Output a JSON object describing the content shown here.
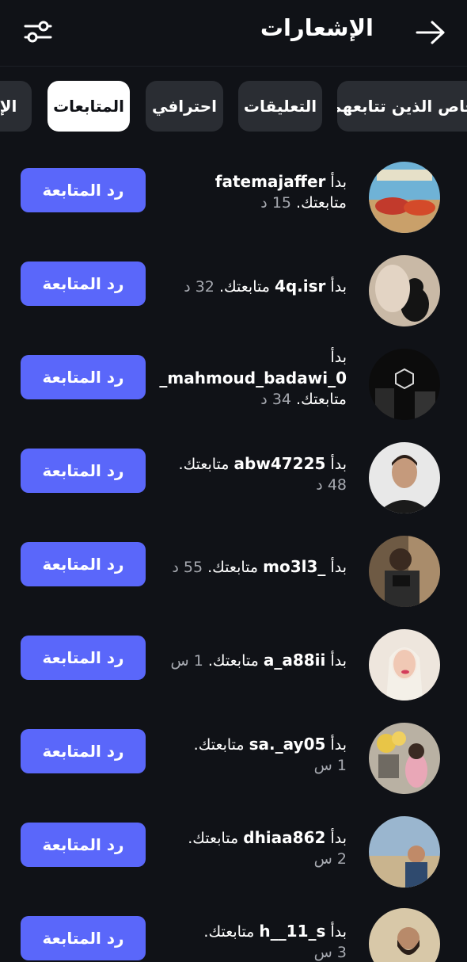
{
  "header": {
    "title": "الإشعارات"
  },
  "tabs": [
    {
      "label": "خاص الذين تتابعهم"
    },
    {
      "label": "التعليقات"
    },
    {
      "label": "احترافي"
    },
    {
      "label": "المتابعات"
    },
    {
      "label": "الإش"
    }
  ],
  "active_tab": "المتابعات",
  "notifications": [
    {
      "prefix": "بدأ",
      "username": "fatemajaffer",
      "suffix": "متابعتك.",
      "time": "15 د",
      "button": "رد المتابعة"
    },
    {
      "prefix": "بدأ",
      "username": "4q.isr",
      "suffix": "متابعتك.",
      "time": "32 د",
      "button": "رد المتابعة"
    },
    {
      "prefix": "بدأ",
      "username": "mahmoud_badawi_0_",
      "suffix": "متابعتك.",
      "time": "34 د",
      "button": "رد المتابعة"
    },
    {
      "prefix": "بدأ",
      "username": "abw47225",
      "suffix": "متابعتك.",
      "time": "48 د",
      "button": "رد المتابعة"
    },
    {
      "prefix": "بدأ",
      "username": "_mo3l3",
      "suffix": "متابعتك.",
      "time": "55 د",
      "button": "رد المتابعة"
    },
    {
      "prefix": "بدأ",
      "username": "a_a88ii",
      "suffix": "متابعتك.",
      "time": "1 س",
      "button": "رد المتابعة"
    },
    {
      "prefix": "بدأ",
      "username": "sa._ay05",
      "suffix": "متابعتك.",
      "time": "1 س",
      "button": "رد المتابعة"
    },
    {
      "prefix": "بدأ",
      "username": "dhiaa862",
      "suffix": "متابعتك.",
      "time": "2 س",
      "button": "رد المتابعة"
    },
    {
      "prefix": "بدأ",
      "username": "h__11_s",
      "suffix": "متابعتك.",
      "time": "3 س",
      "button": "رد المتابعة"
    }
  ],
  "colors": {
    "background": "#101217",
    "button": "#5a67fa",
    "tab": "#2a2d33",
    "tab_active": "#ffffff",
    "muted": "#a6a9b0"
  },
  "icons": {
    "filter": "sliders-icon",
    "back": "arrow-right-icon"
  }
}
